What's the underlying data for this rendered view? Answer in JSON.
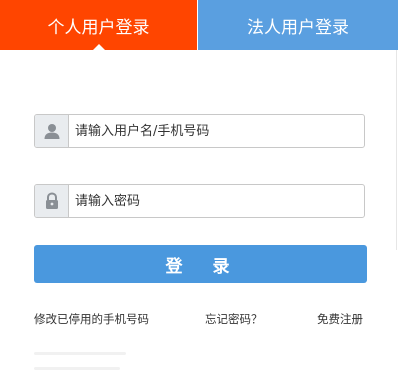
{
  "colors": {
    "active_tab": "#ff4500",
    "inactive_tab": "#5a9fe0",
    "login_button": "#4a98de"
  },
  "tabs": {
    "personal": {
      "label": "个人用户登录",
      "active": true
    },
    "legal": {
      "label": "法人用户登录",
      "active": false
    }
  },
  "form": {
    "username": {
      "icon": "user-icon",
      "placeholder": "请输入用户名/手机号码",
      "value": ""
    },
    "password": {
      "icon": "lock-icon",
      "placeholder": "请输入密码",
      "value": ""
    },
    "login_label": "登 录"
  },
  "links": {
    "change_phone": "修改已停用的手机号码",
    "forgot_password": "忘记密码？",
    "register": "免费注册"
  }
}
